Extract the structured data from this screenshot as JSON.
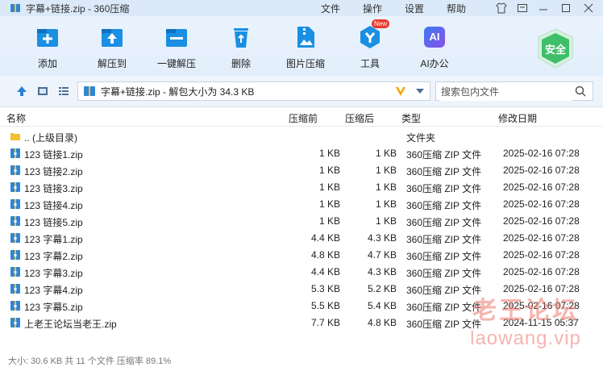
{
  "window": {
    "title": "字幕+链接.zip - 360压缩",
    "menu": [
      "文件",
      "操作",
      "设置",
      "帮助"
    ]
  },
  "toolbar": {
    "items": [
      {
        "label": "添加",
        "icon": "add-icon"
      },
      {
        "label": "解压到",
        "icon": "extract-to-icon"
      },
      {
        "label": "一键解压",
        "icon": "one-click-extract-icon"
      },
      {
        "label": "删除",
        "icon": "recycle-bin-icon"
      },
      {
        "label": "图片压缩",
        "icon": "image-compress-icon"
      },
      {
        "label": "工具",
        "icon": "tools-icon",
        "badge": "New"
      },
      {
        "label": "AI办公",
        "icon": "ai-office-icon",
        "icon_text": "AI"
      }
    ],
    "safe_label": "安全"
  },
  "address": {
    "path_text": "字幕+链接.zip - 解包大小为 34.3 KB",
    "search_placeholder": "搜索包内文件"
  },
  "columns": {
    "name": "名称",
    "compressed_before": "压缩前",
    "compressed_after": "压缩后",
    "type": "类型",
    "modified": "修改日期"
  },
  "files": [
    {
      "name": ".. (上级目录)",
      "before": "",
      "after": "",
      "type": "文件夹",
      "date": "",
      "kind": "folder"
    },
    {
      "name": "123 链接1.zip",
      "before": "1 KB",
      "after": "1 KB",
      "type": "360压缩 ZIP 文件",
      "date": "2025-02-16 07:28",
      "kind": "zip"
    },
    {
      "name": "123 链接2.zip",
      "before": "1 KB",
      "after": "1 KB",
      "type": "360压缩 ZIP 文件",
      "date": "2025-02-16 07:28",
      "kind": "zip"
    },
    {
      "name": "123 链接3.zip",
      "before": "1 KB",
      "after": "1 KB",
      "type": "360压缩 ZIP 文件",
      "date": "2025-02-16 07:28",
      "kind": "zip"
    },
    {
      "name": "123 链接4.zip",
      "before": "1 KB",
      "after": "1 KB",
      "type": "360压缩 ZIP 文件",
      "date": "2025-02-16 07:28",
      "kind": "zip"
    },
    {
      "name": "123 链接5.zip",
      "before": "1 KB",
      "after": "1 KB",
      "type": "360压缩 ZIP 文件",
      "date": "2025-02-16 07:28",
      "kind": "zip"
    },
    {
      "name": "123 字幕1.zip",
      "before": "4.4 KB",
      "after": "4.3 KB",
      "type": "360压缩 ZIP 文件",
      "date": "2025-02-16 07:28",
      "kind": "zip"
    },
    {
      "name": "123 字幕2.zip",
      "before": "4.8 KB",
      "after": "4.7 KB",
      "type": "360压缩 ZIP 文件",
      "date": "2025-02-16 07:28",
      "kind": "zip"
    },
    {
      "name": "123 字幕3.zip",
      "before": "4.4 KB",
      "after": "4.3 KB",
      "type": "360压缩 ZIP 文件",
      "date": "2025-02-16 07:28",
      "kind": "zip"
    },
    {
      "name": "123 字幕4.zip",
      "before": "5.3 KB",
      "after": "5.2 KB",
      "type": "360压缩 ZIP 文件",
      "date": "2025-02-16 07:28",
      "kind": "zip"
    },
    {
      "name": "123 字幕5.zip",
      "before": "5.5 KB",
      "after": "5.4 KB",
      "type": "360压缩 ZIP 文件",
      "date": "2025-02-16 07:28",
      "kind": "zip"
    },
    {
      "name": "上老王论坛当老王.zip",
      "before": "7.7 KB",
      "after": "4.8 KB",
      "type": "360压缩 ZIP 文件",
      "date": "2024-11-15 05:37",
      "kind": "zip"
    }
  ],
  "status": "大小: 30.6 KB 共 11 个文件 压缩率 89.1%",
  "watermark": {
    "line1": "老王论坛",
    "line2": "laowang.vip"
  },
  "colors": {
    "accent": "#1a8fe3",
    "safe_green": "#3fbf6a",
    "badge_red": "#e83a2e",
    "chevron_orange": "#f0a500"
  }
}
